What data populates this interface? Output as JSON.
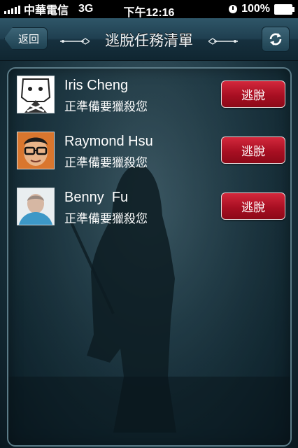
{
  "status_bar": {
    "carrier": "中華電信",
    "network": "3G",
    "time": "下午12:16",
    "battery": "100%"
  },
  "nav": {
    "back_label": "返回",
    "title": "逃脫任務清單",
    "refresh_icon": "refresh-icon"
  },
  "list": {
    "items": [
      {
        "name": "Iris Cheng",
        "status": "正準備要獵殺您",
        "action": "逃脫"
      },
      {
        "name": "Raymond Hsu",
        "status": "正準備要獵殺您",
        "action": "逃脫"
      },
      {
        "name": "Benny  Fu",
        "status": "正準備要獵殺您",
        "action": "逃脫"
      }
    ]
  },
  "colors": {
    "accent_button": "#b01427",
    "nav_bar": "#1f3f50",
    "panel_border": "#5b7b87"
  }
}
